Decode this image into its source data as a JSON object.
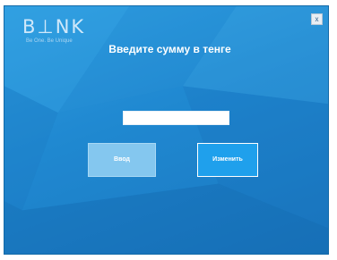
{
  "logo": {
    "word": "B⊥NK",
    "tagline": "Be One. Be Unique"
  },
  "header": {
    "close_label": "x",
    "title": "Введите сумму в тенге"
  },
  "form": {
    "amount_value": "",
    "amount_placeholder": ""
  },
  "buttons": {
    "enter_label": "Ввод",
    "change_label": "Изменить"
  },
  "colors": {
    "background": "#1f86cf",
    "enter_button": "#84c7ef",
    "change_button": "#1fa0ec"
  }
}
